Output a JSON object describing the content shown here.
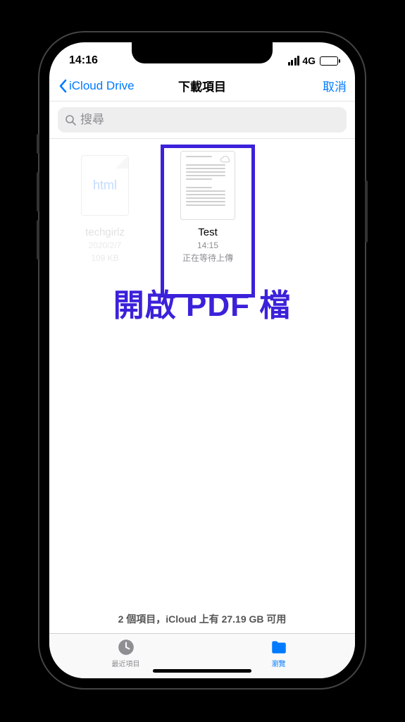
{
  "status": {
    "time": "14:16",
    "network": "4G"
  },
  "nav": {
    "back_label": "iCloud Drive",
    "title": "下載項目",
    "cancel": "取消"
  },
  "search": {
    "placeholder": "搜尋"
  },
  "files": [
    {
      "name": "techgirlz",
      "date": "2020/2/7",
      "size": "109 KB",
      "type_label": "html"
    },
    {
      "name": "Test",
      "time": "14:15",
      "status": "正在等待上傳"
    }
  ],
  "annotation": "開啟 PDF 檔",
  "footer": {
    "info": "2 個項目，iCloud 上有 27.19 GB 可用"
  },
  "tabs": {
    "recent": "最近項目",
    "browse": "瀏覽"
  }
}
